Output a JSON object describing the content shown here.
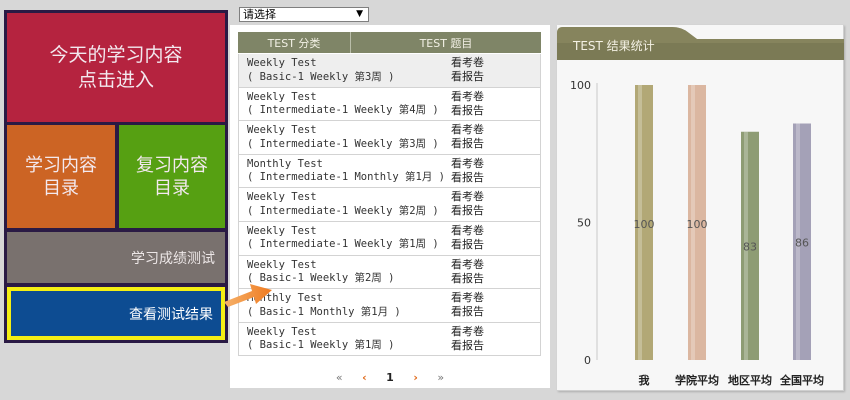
{
  "menu": {
    "today_line1": "今天的学习内容",
    "today_line2": "点击进入",
    "learn_line1": "学习内容",
    "learn_line2": "目录",
    "review_line1": "复习内容",
    "review_line2": "目录",
    "test": "学习成绩测试",
    "result": "查看测试结果"
  },
  "select": {
    "value": "请选择"
  },
  "table": {
    "headers": [
      "TEST 分类",
      "TEST 题目"
    ],
    "rows": [
      {
        "line1": "Weekly Test",
        "line2": "( Basic-1 Weekly 第3周 )",
        "paper": "看考卷",
        "report": "看报告"
      },
      {
        "line1": "Weekly Test",
        "line2": "( Intermediate-1 Weekly 第4周 )",
        "paper": "看考卷",
        "report": "看报告"
      },
      {
        "line1": "Weekly Test",
        "line2": "( Intermediate-1 Weekly 第3周 )",
        "paper": "看考卷",
        "report": "看报告"
      },
      {
        "line1": "Monthly Test",
        "line2": "( Intermediate-1 Monthly 第1月 )",
        "paper": "看考卷",
        "report": "看报告"
      },
      {
        "line1": "Weekly Test",
        "line2": "( Intermediate-1 Weekly 第2周 )",
        "paper": "看考卷",
        "report": "看报告"
      },
      {
        "line1": "Weekly Test",
        "line2": "( Intermediate-1 Weekly 第1周 )",
        "paper": "看考卷",
        "report": "看报告"
      },
      {
        "line1": "Weekly Test",
        "line2": "( Basic-1 Weekly 第2周 )",
        "paper": "看考卷",
        "report": "看报告"
      },
      {
        "line1": "Monthly Test",
        "line2": "( Basic-1 Monthly 第1月 )",
        "paper": "看考卷",
        "report": "看报告"
      },
      {
        "line1": "Weekly Test",
        "line2": "( Basic-1 Weekly 第1周 )",
        "paper": "看考卷",
        "report": "看报告"
      }
    ]
  },
  "pager": {
    "first": "«",
    "prev": "‹",
    "current": "1",
    "next": "›",
    "last": "»"
  },
  "stats": {
    "title": "TEST 结果统计"
  },
  "chart_data": {
    "type": "bar",
    "title": "",
    "categories": [
      "我",
      "学院平均",
      "地区平均",
      "全国平均"
    ],
    "values": [
      100,
      100,
      83,
      86
    ],
    "colors": [
      "#b2a876",
      "#dbb7a1",
      "#8e9c74",
      "#a4a1b7"
    ],
    "ylim": [
      0,
      100
    ],
    "yticks": [
      0,
      50,
      100
    ],
    "xlabel": "",
    "ylabel": ""
  },
  "icons": {
    "arrow": "orange-arrow-icon",
    "dropdown": "chevron-down-icon"
  }
}
